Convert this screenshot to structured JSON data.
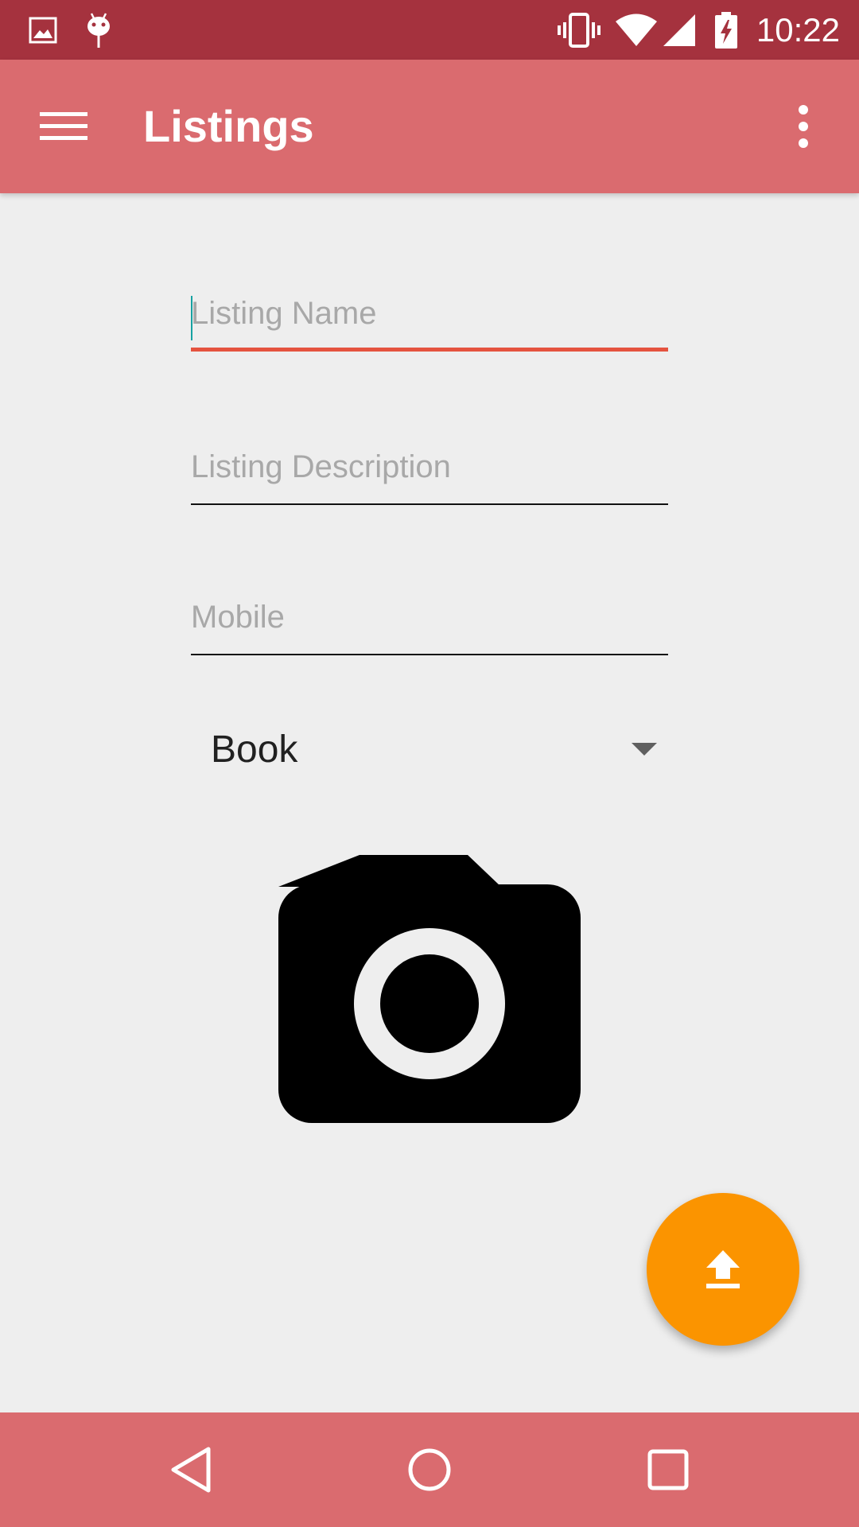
{
  "status_bar": {
    "time": "10:22",
    "icons": [
      "image-notification-icon",
      "android-debug-icon",
      "vibrate-icon",
      "wifi-icon",
      "cell-signal-icon",
      "battery-charging-icon"
    ]
  },
  "app_bar": {
    "title": "Listings",
    "menu_icon": "hamburger-menu-icon",
    "overflow_icon": "more-vert-icon"
  },
  "form": {
    "listing_name": {
      "value": "",
      "placeholder": "Listing Name"
    },
    "listing_description": {
      "value": "",
      "placeholder": "Listing Description"
    },
    "mobile": {
      "value": "",
      "placeholder": "Mobile"
    },
    "category": {
      "selected": "Book"
    },
    "camera_icon": "camera-icon",
    "upload_icon": "upload-icon"
  },
  "nav_bar": {
    "back_icon": "back-triangle-icon",
    "home_icon": "home-circle-icon",
    "recents_icon": "recents-square-icon"
  },
  "colors": {
    "status_bar": "#a5323e",
    "app_bar": "#da6b6f",
    "background": "#eeeeee",
    "focused_underline": "#e5533f",
    "fab": "#fb9400",
    "cursor": "#17a2a2"
  }
}
